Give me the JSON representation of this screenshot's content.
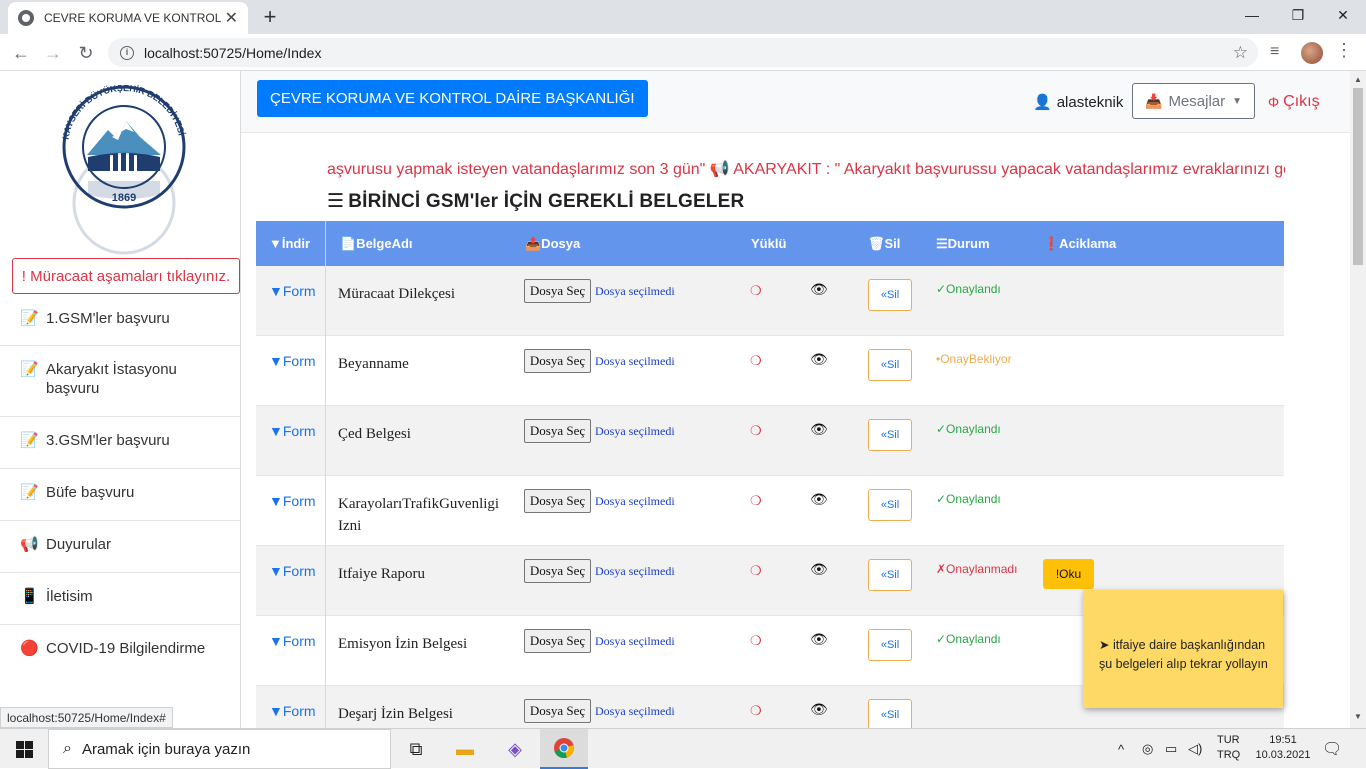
{
  "browser": {
    "tab_title": "CEVRE KORUMA VE KONTROL DA",
    "tab_close": "✕",
    "new_tab": "+",
    "url": "localhost:50725/Home/Index",
    "status_url": "localhost:50725/Home/Index#",
    "minimize": "—",
    "maximize": "❐",
    "close": "✕"
  },
  "sidebar": {
    "logo_text_top": "KAYSERİ BÜYÜKŞEHİR BELEDİYESİ",
    "logo_year": "1869",
    "alert_button": "! Müracaat aşamaları tıklayınız.",
    "items": [
      {
        "label": "1.GSM'ler başvuru",
        "icon": "📝"
      },
      {
        "label": "Akaryakıt İstasyonu başvuru",
        "icon": "📝"
      },
      {
        "label": "3.GSM'ler başvuru",
        "icon": "📝"
      },
      {
        "label": "Büfe başvuru",
        "icon": "📝"
      },
      {
        "label": "Duyurular",
        "icon": "📢"
      },
      {
        "label": "İletisim",
        "icon": "📱"
      },
      {
        "label": "COVID-19 Bilgilendirme",
        "icon": "🔴"
      }
    ]
  },
  "header": {
    "brand": "ÇEVRE KORUMA VE KONTROL DAİRE BAŞKANLIĞI",
    "username": "alasteknik",
    "messages": "Mesajlar",
    "logout": "Çıkış"
  },
  "marquee": "aşvurusu yapmak isteyen vatandaşlarımız son 3 gün\" 📢 AKARYAKIT : \" Akaryakıt başvurussu yapacak vatandaşlarımız evraklarınızı gön",
  "section_title": "BİRİNCİ GSM'ler İÇİN GEREKLİ BELGELER",
  "table": {
    "headers": {
      "indir": "▼İndir",
      "belge": "📄BelgeAdı",
      "dosya": "📤Dosya",
      "yuklu": "Yüklü",
      "sil": "🗑Sil",
      "durum": "☰Durum",
      "aciklama": "❗Aciklama"
    },
    "form_label": "▼Form",
    "file_button": "Dosya Seç",
    "file_none": "Dosya seçilmedi",
    "loaded_glyph": "❍",
    "view_glyph": "👁",
    "delete_label": "«Sil",
    "rows": [
      {
        "name": "Müracaat Dilekçesi",
        "status": "✓Onaylandı",
        "status_type": "ok",
        "note": ""
      },
      {
        "name": "Beyanname",
        "status": "•OnayBekliyor",
        "status_type": "wait",
        "note": ""
      },
      {
        "name": "Çed Belgesi",
        "status": "✓Onaylandı",
        "status_type": "ok",
        "note": ""
      },
      {
        "name": "KarayolarıTrafikGuvenligi Izni",
        "status": "✓Onaylandı",
        "status_type": "ok",
        "note": ""
      },
      {
        "name": "Itfaiye Raporu",
        "status": "✗Onaylanmadı",
        "status_type": "no",
        "note": "!Oku"
      },
      {
        "name": "Emisyon İzin Belgesi",
        "status": "✓Onaylandı",
        "status_type": "ok",
        "note": ""
      },
      {
        "name": "Deşarj İzin Belgesi",
        "status": "",
        "status_type": "ok",
        "note": ""
      }
    ]
  },
  "tooltip": "➤ itfaiye daire başkanlığından şu belgeleri alıp tekrar yollayın",
  "taskbar": {
    "search_placeholder": "Aramak için buraya yazın",
    "lang_top": "TUR",
    "lang_bottom": "TRQ",
    "time": "19:51",
    "date": "10.03.2021"
  },
  "colors": {
    "primary": "#007bff",
    "table_header": "#6495ed",
    "danger": "#dc3545",
    "success": "#28a745",
    "warning": "#ffc107"
  }
}
